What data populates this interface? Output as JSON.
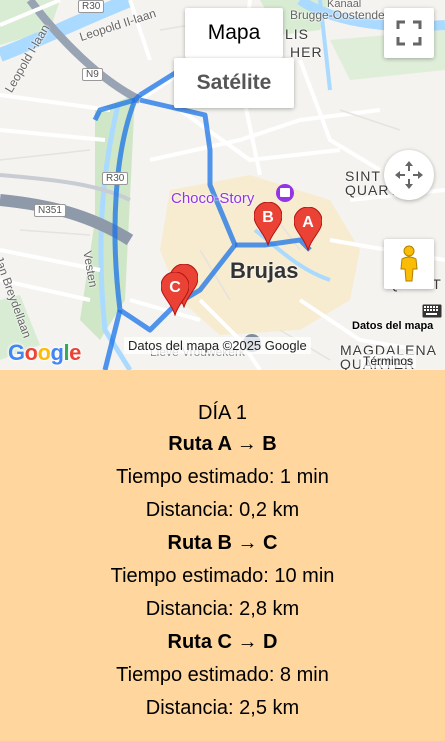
{
  "map": {
    "type_buttons": {
      "map_label": "Mapa",
      "satellite_label": "Satélite"
    },
    "city_labels": {
      "brujas": "Brujas",
      "choco_story": "Choco-Story",
      "sint_anna_top": "SINT",
      "sint_anna_bottom": "QUART",
      "quarter_right": "QUART",
      "lis": "LIS",
      "her": "HER",
      "magdalena": "MAGDALENA",
      "quarter_bottom": "QUARTER",
      "kanaal": "Kanaal",
      "brugge_oostende": "Brugge-Oostende"
    },
    "road_labels": {
      "leopold_ii": "Leopold II-laan",
      "leopold_i": "Leopold I-laan",
      "vesten": "Vesten",
      "breydellaan": "Jan Breydellaan",
      "lieve": "Lieve Vrouwekerk"
    },
    "shields": {
      "r30_top": "R30",
      "n9": "N9",
      "r30_left": "R30",
      "n351": "N351"
    },
    "markers": [
      {
        "label": "A"
      },
      {
        "label": "B"
      },
      {
        "label": "C"
      }
    ],
    "attribution": {
      "logo": "Google",
      "data_label": "Datos del mapa",
      "credit": "Datos del mapa ©2025 Google",
      "terms": "Términos"
    },
    "icons": {
      "fullscreen": "fullscreen-icon",
      "camera": "camera-control-icon",
      "pegman": "pegman-icon",
      "keyboard": "keyboard-icon",
      "museum": "museum-icon"
    },
    "colors": {
      "route": "#4285f4",
      "marker": "#ea4335",
      "panel_bg": "#fed69e",
      "google_blue": "#4285f4",
      "google_red": "#ea4335",
      "google_yellow": "#fbbc05",
      "google_green": "#34a853"
    }
  },
  "itinerary": {
    "day": "DÍA 1",
    "routes": [
      {
        "title": "Ruta A → B",
        "time": "Tiempo estimado: 1 min",
        "distance": "Distancia: 0,2 km"
      },
      {
        "title": "Ruta B → C",
        "time": "Tiempo estimado: 10 min",
        "distance": "Distancia: 2,8 km"
      },
      {
        "title": "Ruta C → D",
        "time": "Tiempo estimado: 8 min",
        "distance": "Distancia: 2,5 km"
      }
    ]
  }
}
